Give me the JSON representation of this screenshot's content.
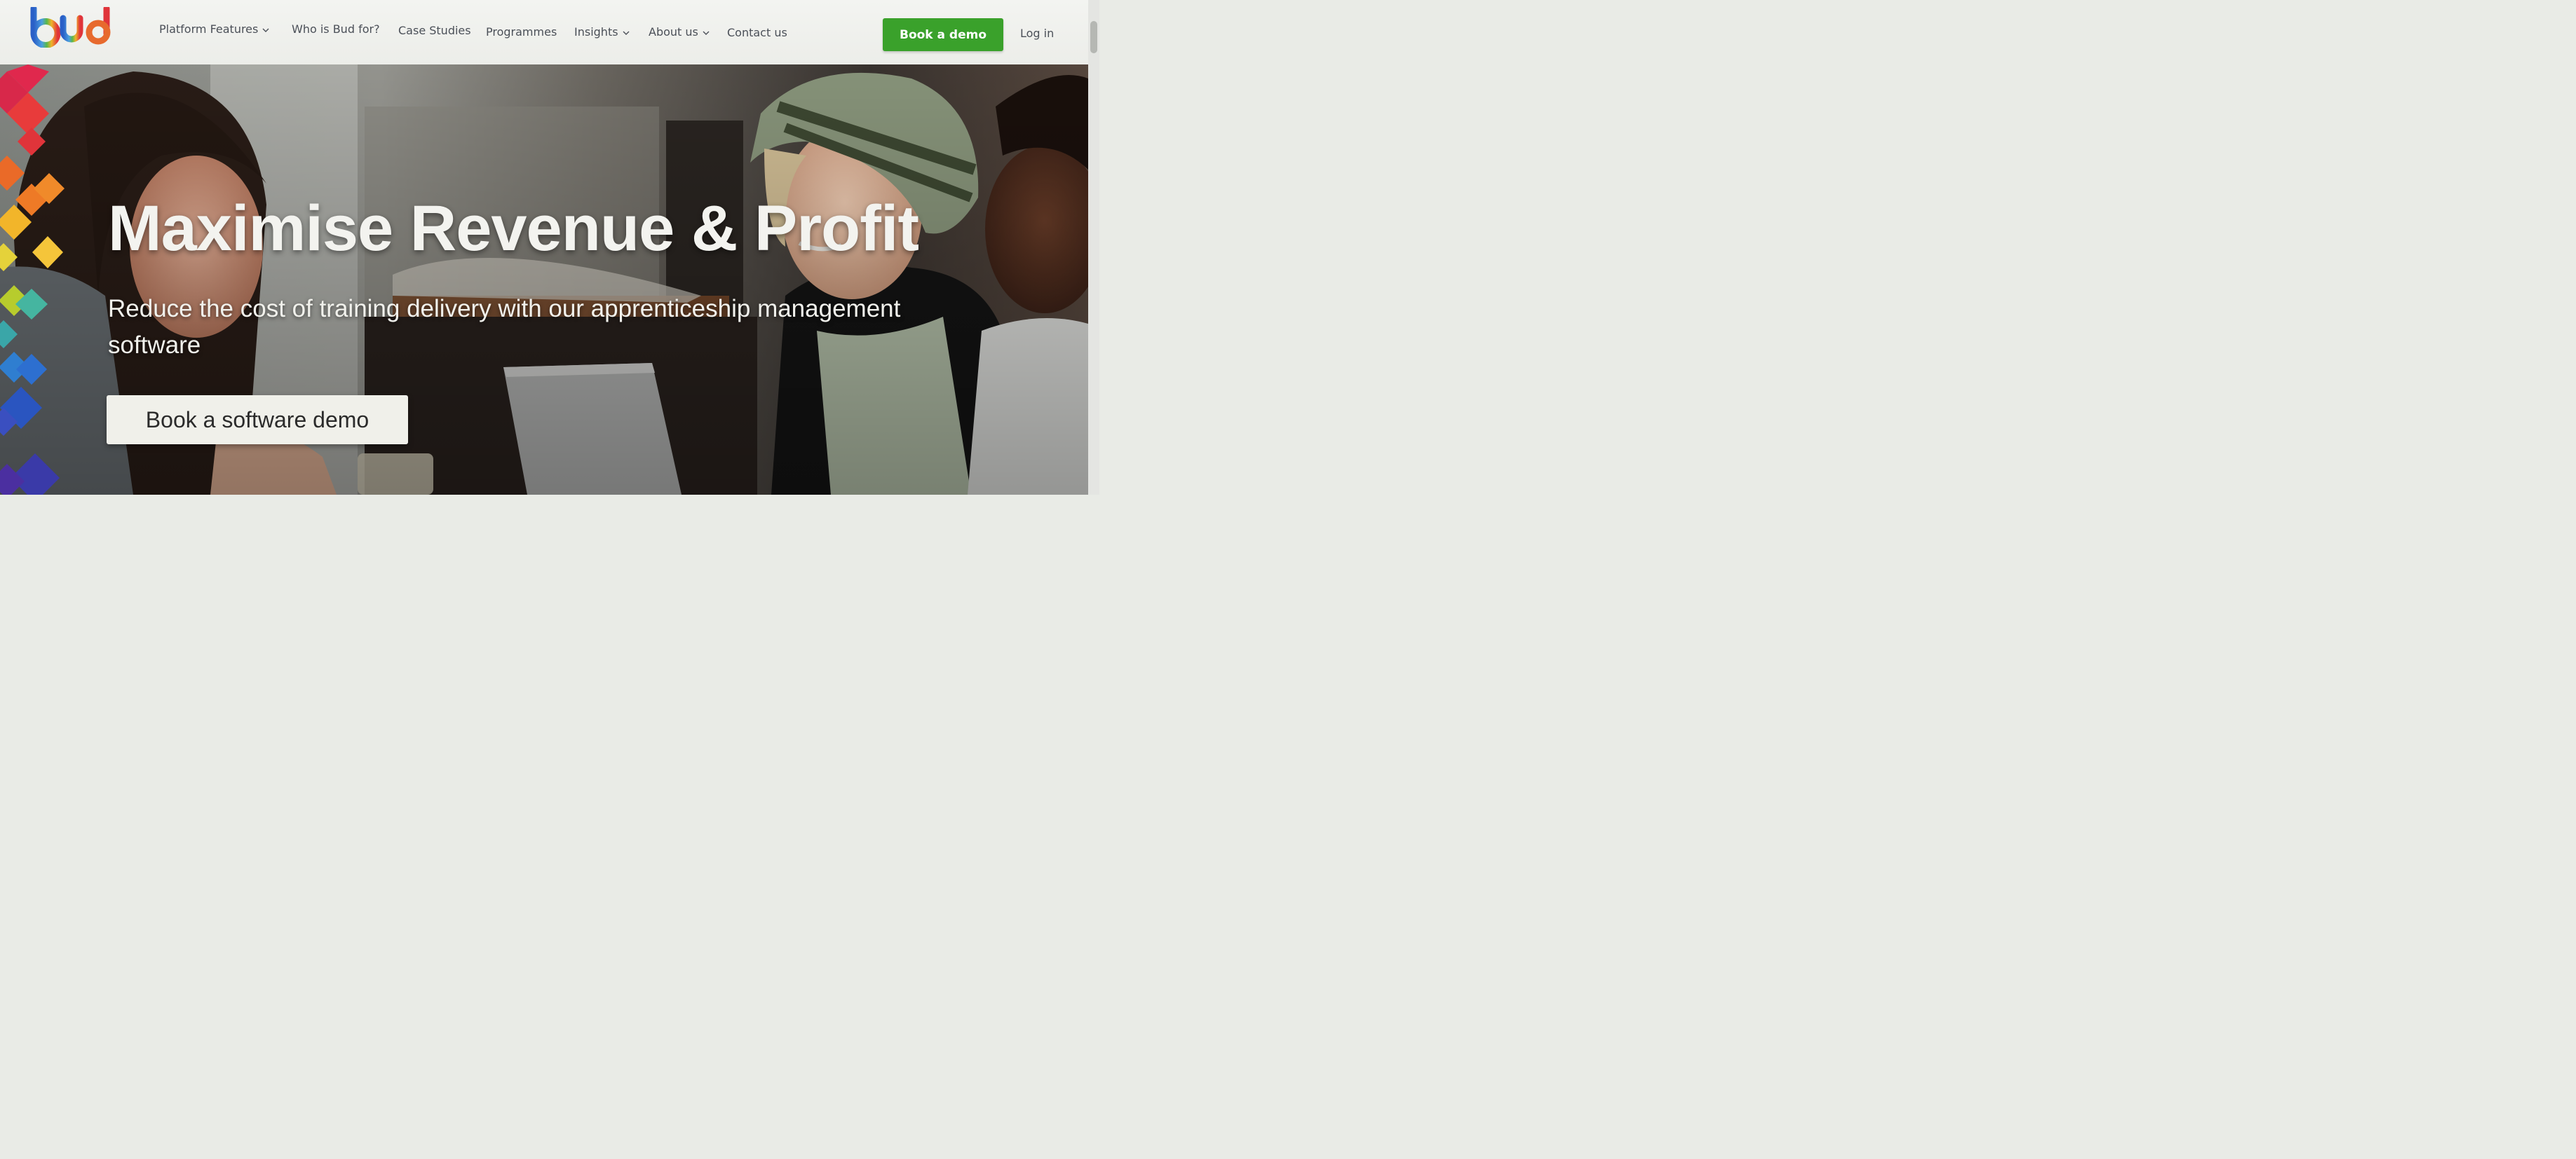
{
  "brand": {
    "logo_text": "bud",
    "colors": {
      "green": "#3aa12b",
      "logo_blue": "#2a5fc7",
      "logo_purple": "#7a3fb0",
      "logo_red": "#e0343a"
    }
  },
  "nav": {
    "items": [
      {
        "label": "Platform Features",
        "has_dropdown": true
      },
      {
        "label": "Who is Bud for?",
        "has_dropdown": false
      },
      {
        "label": "Case Studies",
        "has_dropdown": false
      },
      {
        "label": "Programmes",
        "has_dropdown": false
      },
      {
        "label": "Insights",
        "has_dropdown": true
      },
      {
        "label": "About us",
        "has_dropdown": true
      },
      {
        "label": "Contact us",
        "has_dropdown": false
      }
    ],
    "cta_label": "Book a demo",
    "login_label": "Log in"
  },
  "hero": {
    "title": "Maximise Revenue & Profit",
    "subtitle": "Reduce the cost of training delivery with our apprenticeship management software",
    "cta_label": "Book a software demo",
    "image_description_icon": "hero-photo"
  },
  "icons": {
    "dropdown": "chevron-down-icon",
    "mosaic": "colour-mosaic"
  }
}
